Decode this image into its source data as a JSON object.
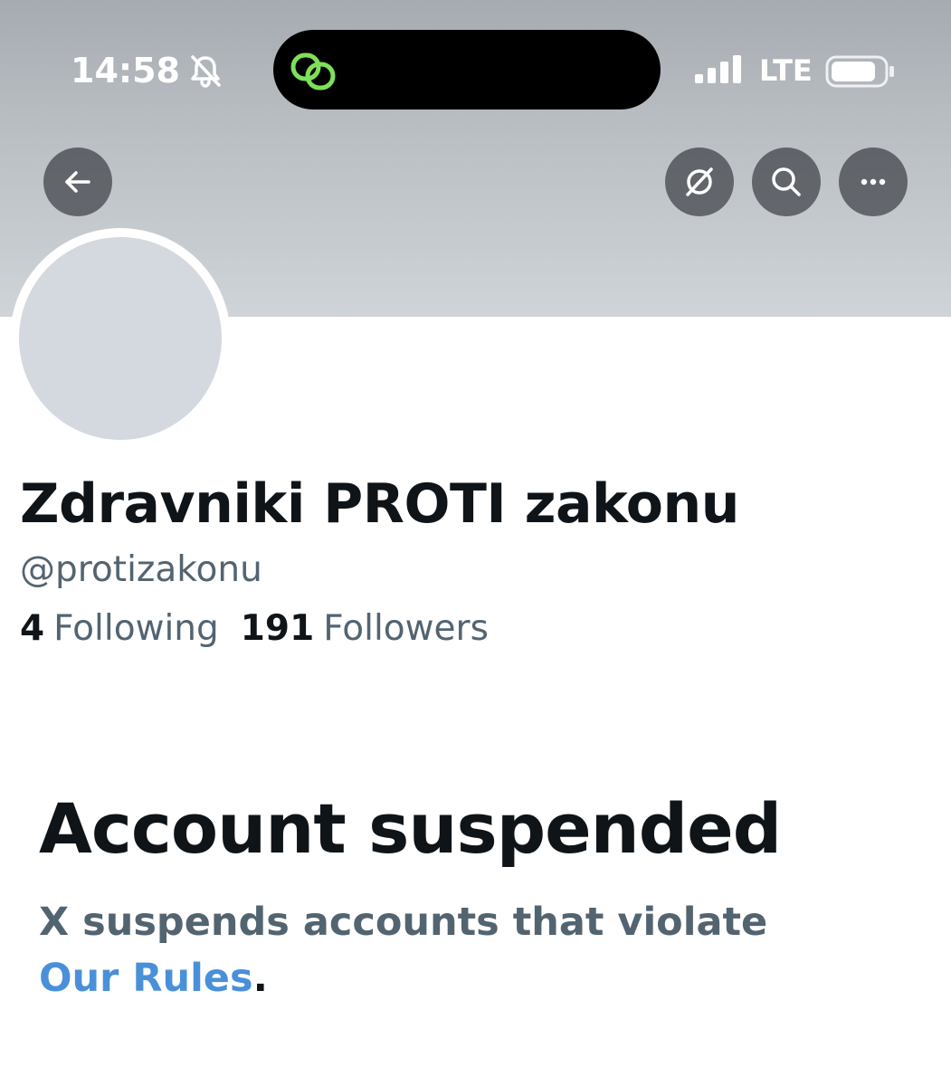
{
  "status_bar": {
    "time": "14:58",
    "network": "LTE",
    "icons": [
      "bell-off-icon",
      "link-icon",
      "signal-icon",
      "battery-icon"
    ]
  },
  "header": {
    "buttons": [
      "back-arrow-icon",
      "grok-icon",
      "search-icon",
      "more-icon"
    ]
  },
  "profile": {
    "display_name": "Zdravniki PROTI zakonu",
    "handle": "@protizakonu",
    "following_count": "4",
    "following_label": "Following",
    "followers_count": "191",
    "followers_label": "Followers"
  },
  "suspension": {
    "title": "Account suspended",
    "message": "X suspends accounts that violate",
    "link_text": "Our Rules",
    "end_punctuation": "."
  },
  "colors": {
    "text_primary": "#0f1419",
    "text_secondary": "#536471",
    "link": "#4a90d9",
    "island_accent": "#7ee05a"
  }
}
